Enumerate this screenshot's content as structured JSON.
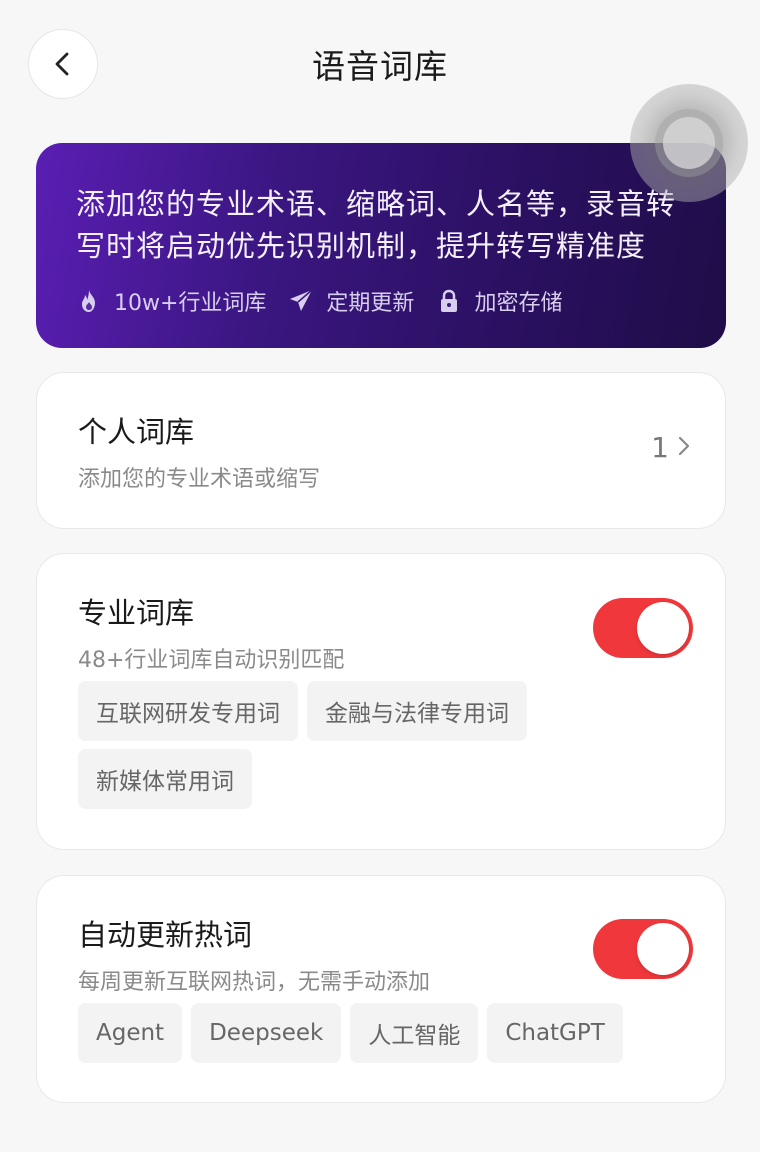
{
  "header": {
    "title": "语音词库",
    "back_icon": "chevron-left-icon"
  },
  "banner": {
    "line1": "添加您的专业术语、缩略词、人名等，录音转",
    "line2": "写时将启动优先识别机制，提升转写精准度",
    "features": [
      {
        "icon": "flame-icon",
        "label": "10w+行业词库"
      },
      {
        "icon": "paper-plane-icon",
        "label": "定期更新"
      },
      {
        "icon": "lock-icon",
        "label": "加密存储"
      }
    ],
    "gradient_start": "#5a1eb3",
    "gradient_end": "#1f0d48"
  },
  "personal": {
    "title": "个人词库",
    "subtitle": "添加您的专业术语或缩写",
    "count": "1"
  },
  "professional": {
    "title": "专业词库",
    "subtitle": "48+行业词库自动识别匹配",
    "enabled": true,
    "chips": [
      "互联网研发专用词",
      "金融与法律专用词",
      "新媒体常用词"
    ]
  },
  "hotwords": {
    "title": "自动更新热词",
    "subtitle": "每周更新互联网热词，无需手动添加",
    "enabled": true,
    "chips": [
      "Agent",
      "Deepseek",
      "人工智能",
      "ChatGPT"
    ]
  },
  "colors": {
    "toggle_on": "#f0383c",
    "background": "#f7f7f7"
  }
}
